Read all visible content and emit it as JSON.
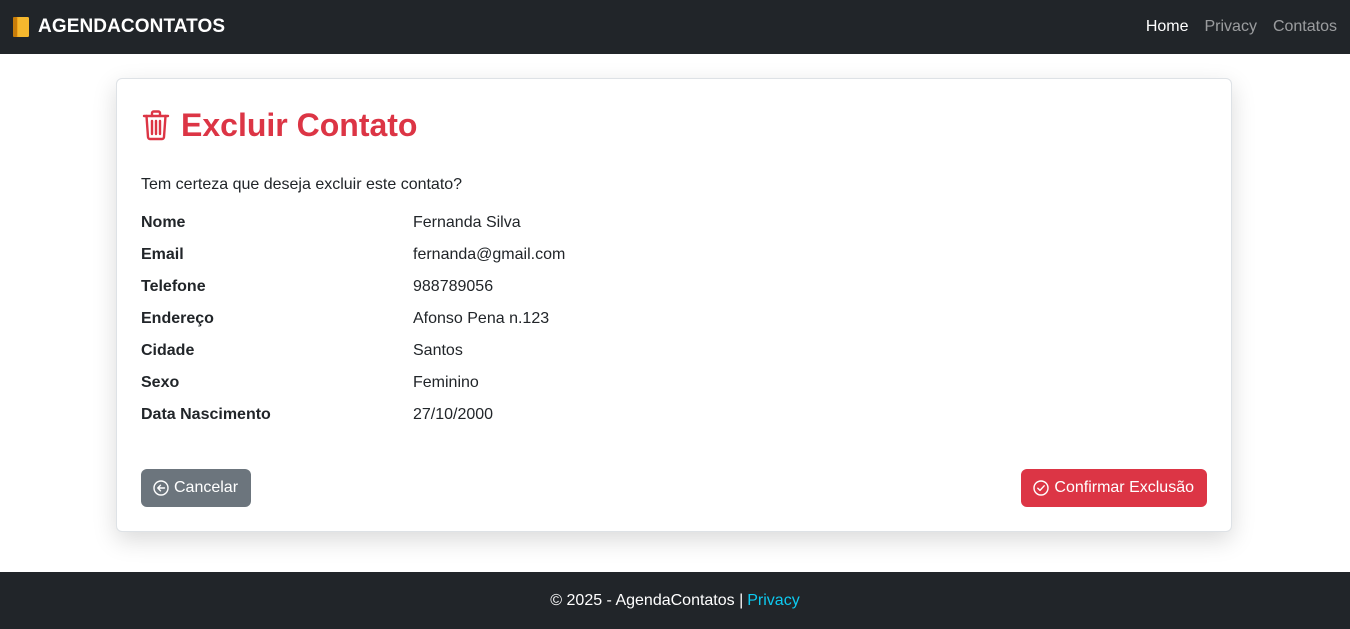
{
  "navbar": {
    "brand": "AGENDACONTATOS",
    "brand_icon": "notebook-icon",
    "links": [
      {
        "label": "Home",
        "active": true
      },
      {
        "label": "Privacy",
        "active": false
      },
      {
        "label": "Contatos",
        "active": false
      }
    ]
  },
  "card": {
    "title": "Excluir Contato",
    "title_icon": "trash-icon",
    "question": "Tem certeza que deseja excluir este contato?",
    "fields": [
      {
        "label": "Nome",
        "value": "Fernanda Silva"
      },
      {
        "label": "Email",
        "value": "fernanda@gmail.com"
      },
      {
        "label": "Telefone",
        "value": "988789056"
      },
      {
        "label": "Endereço",
        "value": "Afonso Pena n.123"
      },
      {
        "label": "Cidade",
        "value": "Santos"
      },
      {
        "label": "Sexo",
        "value": "Feminino"
      },
      {
        "label": "Data Nascimento",
        "value": "27/10/2000"
      }
    ],
    "cancel_label": "Cancelar",
    "confirm_label": "Confirmar Exclusão"
  },
  "footer": {
    "text": "© 2025 - AgendaContatos |",
    "link": "Privacy"
  },
  "colors": {
    "danger": "#dc3545",
    "secondary": "#6c757d",
    "dark": "#212529",
    "info": "#0dcaf0"
  }
}
